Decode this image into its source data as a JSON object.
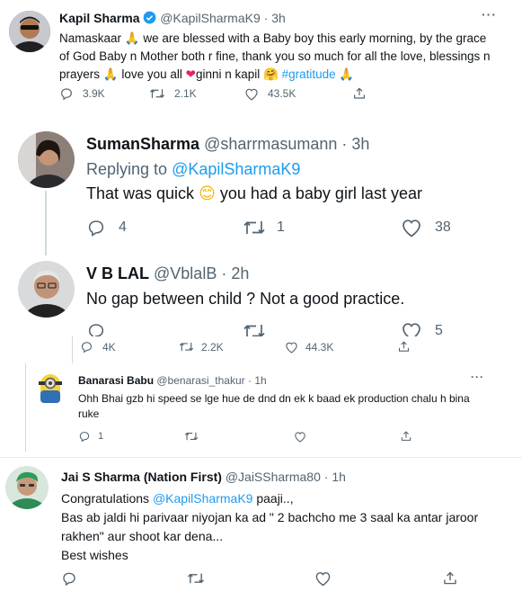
{
  "tweets": [
    {
      "name": "Kapil Sharma",
      "handle": "@KapilSharmaK9",
      "sep": "·",
      "time": "3h",
      "text_pre_1": "Namaskaar ",
      "text_pre_2": " we are blessed with a Baby boy this early morning, by the grace of God Baby n Mother both r fine, thank you so much for all the love, blessings n prayers ",
      "text_pre_3": " love you all ",
      "text_pre_4": "ginni n kapil ",
      "hashtag": "#gratitude",
      "reply_count": "3.9K",
      "retweet_count": "2.1K",
      "like_count": "43.5K"
    },
    {
      "name": "SumanSharma",
      "handle": "@sharrmasumann",
      "sep": "·",
      "time": "3h",
      "replying_to_label": "Replying to",
      "replying_to_handle": "@KapilSharmaK9",
      "text_pre": "That was quick ",
      "text_post": " you had a baby girl last year",
      "reply_count": "4",
      "retweet_count": "1",
      "like_count": "38"
    },
    {
      "name": "V B LAL",
      "handle": "@VblalB",
      "sep": "·",
      "time": "2h",
      "text": "No gap between child ?  Not a good practice.",
      "like_count": "5"
    },
    {
      "reply_count": "4K",
      "retweet_count": "2.2K",
      "like_count": "44.3K"
    },
    {
      "name": "Banarasi Babu",
      "handle": "@benarasi_thakur",
      "sep": "·",
      "time": "1h",
      "text": "Ohh Bhai gzb hi speed se lge hue de dnd dn ek k baad ek production chalu h bina ruke",
      "reply_count": "1"
    },
    {
      "name": "Jai S Sharma (Nation First)",
      "handle": "@JaiSSharma80",
      "sep": "·",
      "time": "1h",
      "line1_pre": "Congratulations ",
      "line1_mention": "@KapilSharmaK9",
      "line1_post": " paaji..,",
      "line2": "Bas ab jaldi hi parivaar niyojan ka ad \" 2 bachcho me 3 saal ka antar jaroor rakhen\" aur shoot kar dena...",
      "line3": "Best wishes"
    }
  ],
  "icons": {
    "more": "more-icon",
    "reply": "reply-icon",
    "retweet": "retweet-icon",
    "like": "like-icon",
    "share": "share-icon",
    "verified": "verified-icon"
  },
  "colors": {
    "link": "#1d9bf0",
    "muted": "#536471",
    "heart": "#e0245e",
    "verified": "#1d9bf0"
  }
}
